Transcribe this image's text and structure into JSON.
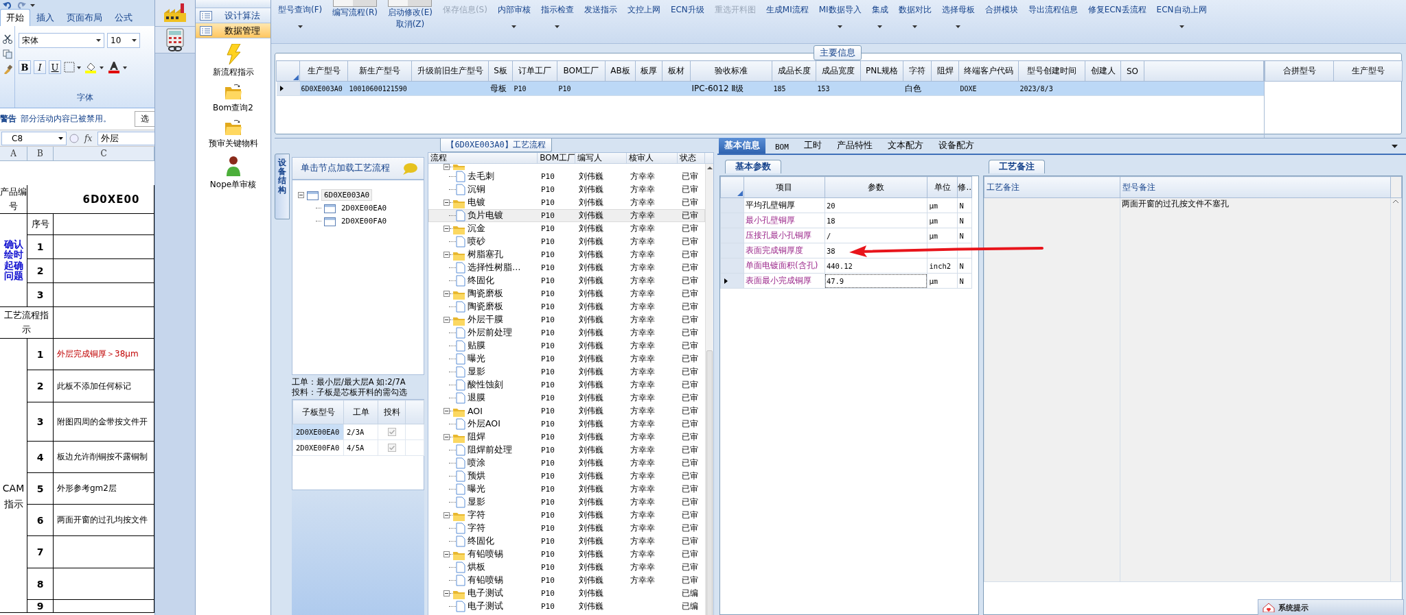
{
  "spreadsheet": {
    "ribbon_tabs": [
      {
        "label": "开始",
        "selected": true
      },
      {
        "label": "插入",
        "selected": false
      },
      {
        "label": "页面布局",
        "selected": false
      },
      {
        "label": "公式",
        "selected": false
      }
    ],
    "font_name": "宋体",
    "font_size": "10",
    "style_buttons": [
      "B",
      "I",
      "U"
    ],
    "group_label": "字体",
    "warning": {
      "title": "警告",
      "message": "部分活动内容已被禁用。",
      "button": "选"
    },
    "name_box": "C8",
    "fx_label": "fx",
    "formula": "外层",
    "columns": [
      "A",
      "B",
      "C"
    ],
    "product_label": "产品编号",
    "product_code": "6D0XE00",
    "confirm_label": "确认绘时起确问题",
    "seq_header": "序号",
    "confirm_rows": [
      "1",
      "2",
      "3"
    ],
    "flow_label": "工艺流程指示",
    "cam_label": "CAM指示",
    "instructions": [
      {
        "no": "1",
        "text": "外层完成铜厚＞38μm",
        "highlighted": true
      },
      {
        "no": "2",
        "text": "此板不添加任何标记",
        "highlighted": false
      },
      {
        "no": "3",
        "text": "附图四周的金带按文件开",
        "highlighted": false
      },
      {
        "no": "4",
        "text": "板边允许削铜按不露铜制",
        "highlighted": false
      },
      {
        "no": "5",
        "text": "外形参考gm2层",
        "highlighted": false
      },
      {
        "no": "6",
        "text": "两面开窗的过孔均按文件",
        "highlighted": false
      },
      {
        "no": "7"
      },
      {
        "no": "8"
      },
      {
        "no": "9"
      }
    ]
  },
  "navigation": {
    "sections": [
      {
        "label": "设计算法",
        "selected": false
      },
      {
        "label": "数据管理",
        "selected": true
      }
    ],
    "items": [
      {
        "label": "新流程指示",
        "kind": "lightning"
      },
      {
        "label": "Bom查询2",
        "kind": "folder"
      },
      {
        "label": "预审关键物料",
        "kind": "folder"
      },
      {
        "label": "Nope单审核",
        "kind": "person"
      }
    ]
  },
  "toolbar": [
    {
      "kind": "button",
      "labels": [
        "型号查询(F)"
      ],
      "dropdown": true,
      "disabled": false
    },
    {
      "kind": "toggle",
      "labels": [
        "编写流程(R)"
      ],
      "dropdown": false,
      "disabled": false,
      "on": false
    },
    {
      "kind": "toggle",
      "labels": [
        "启动修改(E)",
        "取消(Z)"
      ],
      "dropdown": false,
      "disabled": false,
      "on": false
    },
    {
      "kind": "button",
      "labels": [
        "保存信息(S)"
      ],
      "dropdown": false,
      "disabled": true
    },
    {
      "kind": "button",
      "labels": [
        "内部审核"
      ],
      "dropdown": true,
      "disabled": false
    },
    {
      "kind": "button",
      "labels": [
        "指示检查"
      ],
      "dropdown": true,
      "disabled": false
    },
    {
      "kind": "button",
      "labels": [
        "发送指示"
      ],
      "dropdown": false,
      "disabled": false
    },
    {
      "kind": "button",
      "labels": [
        "文控上网"
      ],
      "dropdown": false,
      "disabled": false
    },
    {
      "kind": "button",
      "labels": [
        "ECN升级"
      ],
      "dropdown": false,
      "disabled": false
    },
    {
      "kind": "button",
      "labels": [
        "重选开料图"
      ],
      "dropdown": false,
      "disabled": true
    },
    {
      "kind": "button",
      "labels": [
        "生成MI流程"
      ],
      "dropdown": false,
      "disabled": false
    },
    {
      "kind": "button",
      "labels": [
        "MI数据导入"
      ],
      "dropdown": true,
      "disabled": false
    },
    {
      "kind": "button",
      "labels": [
        "集成"
      ],
      "dropdown": true,
      "disabled": false
    },
    {
      "kind": "button",
      "labels": [
        "数据对比"
      ],
      "dropdown": true,
      "disabled": false
    },
    {
      "kind": "button",
      "labels": [
        "选择母板"
      ],
      "dropdown": true,
      "disabled": false
    },
    {
      "kind": "button",
      "labels": [
        "合拼模块"
      ],
      "dropdown": false,
      "disabled": false
    },
    {
      "kind": "button",
      "labels": [
        "导出流程信息"
      ],
      "dropdown": false,
      "disabled": false
    },
    {
      "kind": "button",
      "labels": [
        "修复ECN丢流程"
      ],
      "dropdown": false,
      "disabled": false
    },
    {
      "kind": "button",
      "labels": [
        "ECN自动上网"
      ],
      "dropdown": true,
      "disabled": false
    }
  ],
  "main_info": {
    "title": "主要信息",
    "columns": [
      "生产型号",
      "新生产型号",
      "升级前旧生产型号",
      "S板",
      "订单工厂",
      "BOM工厂",
      "AB板",
      "板厚",
      "板材",
      "验收标准",
      "成品长度",
      "成品宽度",
      "PNL规格",
      "字符",
      "阻焊",
      "终端客户代码",
      "型号创建时间",
      "创建人",
      "SO"
    ],
    "rows": [
      {
        "selected": true,
        "cells": [
          "6D0XE003A0",
          "10010600121590",
          null,
          "母板",
          "P10",
          "P10",
          null,
          null,
          null,
          "IPC-6012 Ⅱ级",
          "185",
          "153",
          null,
          "白色",
          null,
          "DOXE",
          "2023/8/3",
          null,
          null
        ]
      }
    ],
    "merge_columns": [
      "合拼型号",
      "生产型号"
    ]
  },
  "process_flow": {
    "title": "【6D0XE003A0】工艺流程",
    "side_tab": "设备结构",
    "tree_header": "单击节点加载工艺流程",
    "models": [
      {
        "label": "6D0XE003A0",
        "selected": true,
        "expanded": true,
        "children": [
          {
            "label": "2D0XE00EA0",
            "selected": false
          },
          {
            "label": "2D0XE00FA0",
            "selected": false
          }
        ]
      }
    ],
    "notes": [
      "工单：最小层/最大层A 如:2/7A",
      "投料：子板是芯板开料的需勾选"
    ],
    "sub_columns": [
      "子板型号",
      "工单",
      "投料"
    ],
    "sub_rows": [
      {
        "model": "2D0XE00EA0",
        "order": "2/3A",
        "checked": true,
        "selected": true
      },
      {
        "model": "2D0XE00FA0",
        "order": "4/5A",
        "checked": true,
        "selected": false
      }
    ],
    "columns": [
      "流程",
      "BOM工厂",
      "编写人",
      "核审人",
      "状态"
    ],
    "steps": [
      {
        "selected": false,
        "expanded": true,
        "children": [
          {
            "name": "去毛刺",
            "bom": "P10",
            "writer": "刘伟巍",
            "reviewer": "方幸幸",
            "status": "已审",
            "selected": false
          },
          {
            "name": "沉铜",
            "bom": "P10",
            "writer": "刘伟巍",
            "reviewer": "方幸幸",
            "status": "已审",
            "selected": false
          }
        ]
      },
      {
        "name": "电镀",
        "bom": "P10",
        "writer": "刘伟巍",
        "reviewer": "方幸幸",
        "status": "已审",
        "selected": false,
        "expanded": true,
        "children": [
          {
            "name": "负片电镀",
            "bom": "P10",
            "writer": "刘伟巍",
            "reviewer": "方幸幸",
            "status": "已审",
            "selected": true
          }
        ]
      },
      {
        "name": "沉金",
        "bom": "P10",
        "writer": "刘伟巍",
        "reviewer": "方幸幸",
        "status": "已审",
        "selected": false,
        "expanded": true,
        "children": [
          {
            "name": "喷砂",
            "bom": "P10",
            "writer": "刘伟巍",
            "reviewer": "方幸幸",
            "status": "已审",
            "selected": false
          }
        ]
      },
      {
        "name": "树脂塞孔",
        "bom": "P10",
        "writer": "刘伟巍",
        "reviewer": "方幸幸",
        "status": "已审",
        "selected": false,
        "expanded": true,
        "children": [
          {
            "name": "选择性树脂…",
            "bom": "P10",
            "writer": "刘伟巍",
            "reviewer": "方幸幸",
            "status": "已审",
            "selected": false
          },
          {
            "name": "终固化",
            "bom": "P10",
            "writer": "刘伟巍",
            "reviewer": "方幸幸",
            "status": "已审",
            "selected": false
          }
        ]
      },
      {
        "name": "陶瓷磨板",
        "bom": "P10",
        "writer": "刘伟巍",
        "reviewer": "方幸幸",
        "status": "已审",
        "selected": false,
        "expanded": true,
        "children": [
          {
            "name": "陶瓷磨板",
            "bom": "P10",
            "writer": "刘伟巍",
            "reviewer": "方幸幸",
            "status": "已审",
            "selected": false
          }
        ]
      },
      {
        "name": "外层干膜",
        "bom": "P10",
        "writer": "刘伟巍",
        "reviewer": "方幸幸",
        "status": "已审",
        "selected": false,
        "expanded": true,
        "children": [
          {
            "name": "外层前处理",
            "bom": "P10",
            "writer": "刘伟巍",
            "reviewer": "方幸幸",
            "status": "已审",
            "selected": false
          },
          {
            "name": "贴膜",
            "bom": "P10",
            "writer": "刘伟巍",
            "reviewer": "方幸幸",
            "status": "已审",
            "selected": false
          },
          {
            "name": "曝光",
            "bom": "P10",
            "writer": "刘伟巍",
            "reviewer": "方幸幸",
            "status": "已审",
            "selected": false
          },
          {
            "name": "显影",
            "bom": "P10",
            "writer": "刘伟巍",
            "reviewer": "方幸幸",
            "status": "已审",
            "selected": false
          },
          {
            "name": "酸性蚀刻",
            "bom": "P10",
            "writer": "刘伟巍",
            "reviewer": "方幸幸",
            "status": "已审",
            "selected": false
          },
          {
            "name": "退膜",
            "bom": "P10",
            "writer": "刘伟巍",
            "reviewer": "方幸幸",
            "status": "已审",
            "selected": false
          }
        ]
      },
      {
        "name": "AOI",
        "bom": "P10",
        "writer": "刘伟巍",
        "reviewer": "方幸幸",
        "status": "已审",
        "selected": false,
        "expanded": true,
        "children": [
          {
            "name": "外层AOI",
            "bom": "P10",
            "writer": "刘伟巍",
            "reviewer": "方幸幸",
            "status": "已审",
            "selected": false
          }
        ]
      },
      {
        "name": "阻焊",
        "bom": "P10",
        "writer": "刘伟巍",
        "reviewer": "方幸幸",
        "status": "已审",
        "selected": false,
        "expanded": true,
        "children": [
          {
            "name": "阻焊前处理",
            "bom": "P10",
            "writer": "刘伟巍",
            "reviewer": "方幸幸",
            "status": "已审",
            "selected": false
          },
          {
            "name": "喷涂",
            "bom": "P10",
            "writer": "刘伟巍",
            "reviewer": "方幸幸",
            "status": "已审",
            "selected": false
          },
          {
            "name": "预烘",
            "bom": "P10",
            "writer": "刘伟巍",
            "reviewer": "方幸幸",
            "status": "已审",
            "selected": false
          },
          {
            "name": "曝光",
            "bom": "P10",
            "writer": "刘伟巍",
            "reviewer": "方幸幸",
            "status": "已审",
            "selected": false
          },
          {
            "name": "显影",
            "bom": "P10",
            "writer": "刘伟巍",
            "reviewer": "方幸幸",
            "status": "已审",
            "selected": false
          }
        ]
      },
      {
        "name": "字符",
        "bom": "P10",
        "writer": "刘伟巍",
        "reviewer": "方幸幸",
        "status": "已审",
        "selected": false,
        "expanded": true,
        "children": [
          {
            "name": "字符",
            "bom": "P10",
            "writer": "刘伟巍",
            "reviewer": "方幸幸",
            "status": "已审",
            "selected": false
          },
          {
            "name": "终固化",
            "bom": "P10",
            "writer": "刘伟巍",
            "reviewer": "方幸幸",
            "status": "已审",
            "selected": false
          }
        ]
      },
      {
        "name": "有铅喷锡",
        "bom": "P10",
        "writer": "刘伟巍",
        "reviewer": "方幸幸",
        "status": "已审",
        "selected": false,
        "expanded": true,
        "children": [
          {
            "name": "烘板",
            "bom": "P10",
            "writer": "刘伟巍",
            "reviewer": "方幸幸",
            "status": "已审",
            "selected": false
          },
          {
            "name": "有铅喷锡",
            "bom": "P10",
            "writer": "刘伟巍",
            "reviewer": "方幸幸",
            "status": "已审",
            "selected": false
          }
        ]
      },
      {
        "name": "电子测试",
        "bom": "P10",
        "writer": "刘伟巍",
        "status": "已编",
        "selected": false,
        "expanded": true,
        "children": [
          {
            "name": "电子测试",
            "bom": "P10",
            "writer": "刘伟巍",
            "status": "已编",
            "selected": false
          }
        ]
      }
    ]
  },
  "details": {
    "tabs": [
      {
        "label": "基本信息",
        "selected": true
      },
      {
        "label": "BOM",
        "selected": false
      },
      {
        "label": "工时",
        "selected": false
      },
      {
        "label": "产品特性",
        "selected": false
      },
      {
        "label": "文本配方",
        "selected": false
      },
      {
        "label": "设备配方",
        "selected": false
      }
    ],
    "params_tab": "基本参数",
    "params_columns": [
      "项目",
      "参数",
      "单位",
      "修.."
    ],
    "params": [
      {
        "item": "平均孔壁铜厚",
        "value": "20",
        "unit": "μm",
        "flag": "N",
        "highlighted": false,
        "current": false
      },
      {
        "item": "最小孔壁铜厚",
        "value": "18",
        "unit": "μm",
        "flag": "N",
        "highlighted": true,
        "current": false
      },
      {
        "item": "压接孔最小孔铜厚",
        "value": "/",
        "unit": "μm",
        "flag": "N",
        "highlighted": true,
        "current": false
      },
      {
        "item": "表面完成铜厚度",
        "value": "38",
        "highlighted": true,
        "current": false
      },
      {
        "item": "单面电镀面积(含孔)",
        "value": "440.12",
        "unit": "inch2",
        "flag": "N",
        "highlighted": true,
        "current": false
      },
      {
        "item": "表面最小完成铜厚",
        "value": "47.9",
        "unit": "μm",
        "flag": "N",
        "highlighted": true,
        "current": true
      }
    ],
    "notes_tab": "工艺备注",
    "notes_columns": [
      "工艺备注",
      "型号备注"
    ],
    "model_note": "两面开窗的过孔按文件不塞孔"
  },
  "popup": {
    "title": "系统提示"
  }
}
